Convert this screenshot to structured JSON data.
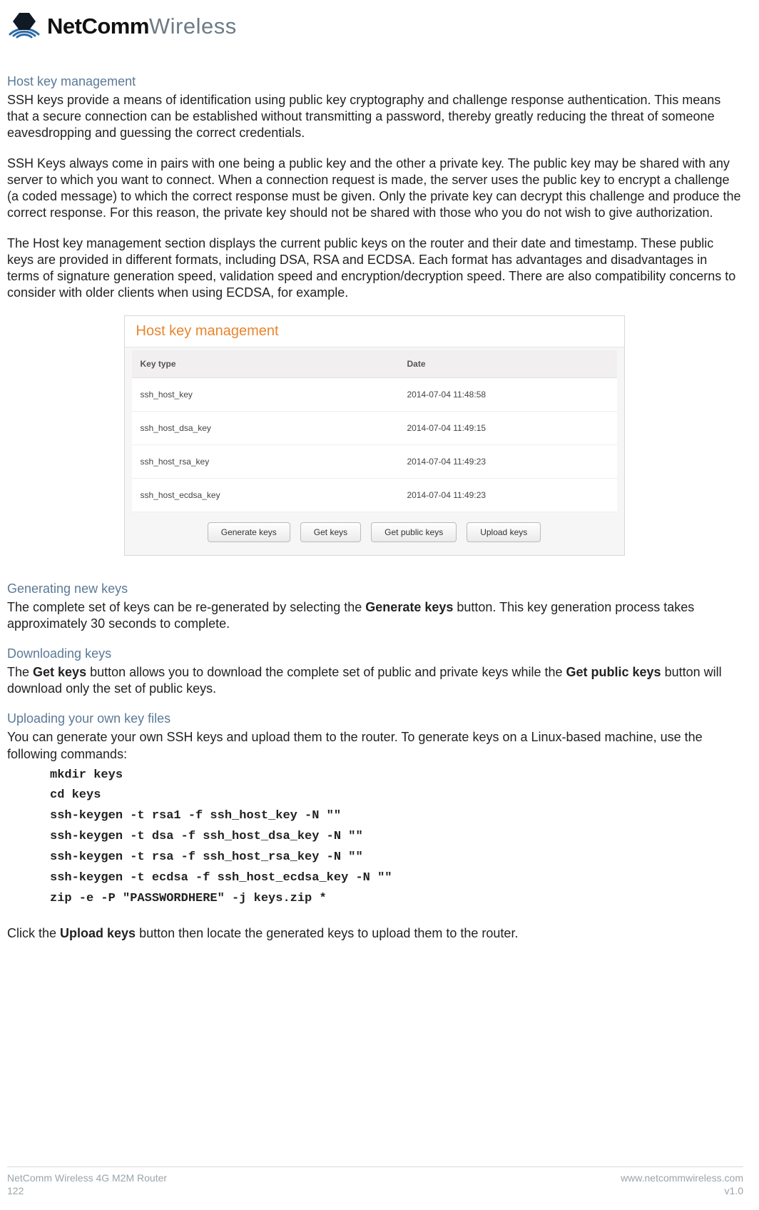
{
  "brand": {
    "bold": "NetComm",
    "thin": "Wireless"
  },
  "sections": {
    "hostkey": {
      "title": "Host key management"
    },
    "gen": {
      "title": "Generating new keys"
    },
    "dl": {
      "title": "Downloading keys"
    },
    "ul": {
      "title": "Uploading your own key files"
    }
  },
  "text": {
    "p1": "SSH keys provide a means of identification using public key cryptography and challenge response authentication. This means that a secure connection can be established without transmitting a password, thereby greatly reducing the threat of someone eavesdropping and guessing the correct credentials.",
    "p2": "SSH Keys always come in pairs with one being a public key and the other a private key. The public key may be shared with any server to which you want to connect. When a connection request is made, the server uses the public key to encrypt a challenge (a coded message) to which the correct response must be given. Only the private key can decrypt this challenge and produce the correct response. For this reason, the private key should not be shared with those who you do not wish to give authorization.",
    "p3": "The Host key management section displays the current public keys on the router and their date and timestamp. These public keys are provided in different formats, including DSA, RSA and ECDSA. Each format has advantages and disadvantages in terms of signature generation speed, validation speed and encryption/decryption speed. There are also compatibility concerns to consider with older clients when using ECDSA, for example.",
    "gen_pre": "The complete set of keys can be re-generated by selecting the ",
    "gen_bold": "Generate keys",
    "gen_post": " button. This key generation process takes approximately 30 seconds to complete.",
    "dl_pre": "The ",
    "dl_b1": "Get keys",
    "dl_mid": " button allows you to download the complete set of public and private keys while the ",
    "dl_b2": "Get public keys",
    "dl_post": " button will download only the set of public keys.",
    "ul": "You can generate your own SSH keys and upload them to the router. To generate keys on a Linux-based machine, use the following commands:",
    "final_pre": "Click the ",
    "final_bold": "Upload keys",
    "final_post": " button then locate the generated keys to upload them to the router."
  },
  "fig": {
    "title": "Host key management",
    "th1": "Key type",
    "th2": "Date",
    "rows": [
      {
        "k": "ssh_host_key",
        "d": "2014-07-04 11:48:58"
      },
      {
        "k": "ssh_host_dsa_key",
        "d": "2014-07-04 11:49:15"
      },
      {
        "k": "ssh_host_rsa_key",
        "d": "2014-07-04 11:49:23"
      },
      {
        "k": "ssh_host_ecdsa_key",
        "d": "2014-07-04 11:49:23"
      }
    ],
    "btn_generate": "Generate keys",
    "btn_get": "Get keys",
    "btn_getpublic": "Get public keys",
    "btn_upload": "Upload keys"
  },
  "code": "mkdir keys\ncd keys\nssh-keygen -t rsa1 -f ssh_host_key -N \"\"\nssh-keygen -t dsa -f ssh_host_dsa_key -N \"\"\nssh-keygen -t rsa -f ssh_host_rsa_key -N \"\"\nssh-keygen -t ecdsa -f ssh_host_ecdsa_key -N \"\"\nzip -e -P \"PASSWORDHERE\" -j keys.zip *",
  "footer": {
    "product": "NetComm Wireless 4G M2M Router",
    "pageno": "122",
    "url": "www.netcommwireless.com",
    "ver": "v1.0"
  }
}
